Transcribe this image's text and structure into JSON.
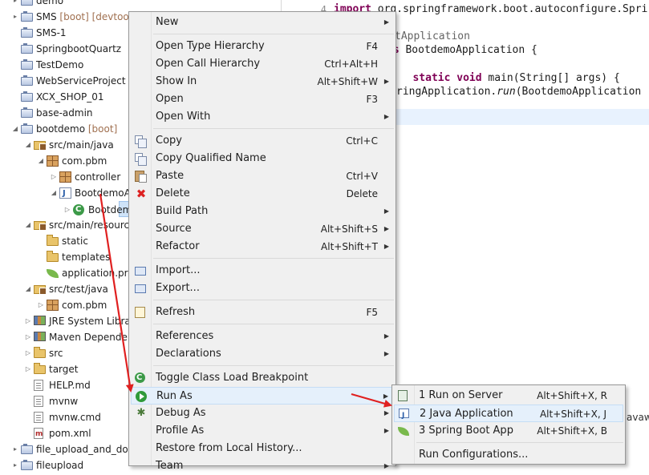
{
  "tree": {
    "items": [
      {
        "label": "demo",
        "decoration": "",
        "indent": 0,
        "icon": "project-icon",
        "twisty": "▸"
      },
      {
        "label": "SMS",
        "decoration": "[boot] [devtoo",
        "indent": 0,
        "icon": "project-icon",
        "twisty": "▸"
      },
      {
        "label": "SMS-1",
        "decoration": "",
        "indent": 0,
        "icon": "project-icon",
        "twisty": ""
      },
      {
        "label": "SpringbootQuartz",
        "decoration": "",
        "indent": 0,
        "icon": "project-icon",
        "twisty": ""
      },
      {
        "label": "TestDemo",
        "decoration": "",
        "indent": 0,
        "icon": "project-icon",
        "twisty": ""
      },
      {
        "label": "WebServiceProject",
        "decoration": "",
        "indent": 0,
        "icon": "project-icon",
        "twisty": ""
      },
      {
        "label": "XCX_SHOP_01",
        "decoration": "",
        "indent": 0,
        "icon": "project-icon",
        "twisty": ""
      },
      {
        "label": "base-admin",
        "decoration": "",
        "indent": 0,
        "icon": "project-icon",
        "twisty": ""
      },
      {
        "label": "bootdemo",
        "decoration": "[boot]",
        "indent": 0,
        "icon": "project-icon",
        "twisty": "◢"
      },
      {
        "label": "src/main/java",
        "decoration": "",
        "indent": 1,
        "icon": "source-folder-icon",
        "twisty": "◢"
      },
      {
        "label": "com.pbm",
        "decoration": "",
        "indent": 2,
        "icon": "package-icon",
        "twisty": "◢"
      },
      {
        "label": "controller",
        "decoration": "",
        "indent": 3,
        "icon": "package-icon",
        "twisty": "▷"
      },
      {
        "label": "BootdemoA",
        "decoration": "",
        "indent": 3,
        "icon": "java-file-icon",
        "twisty": "◢"
      },
      {
        "label": "Bootdem",
        "decoration": "",
        "indent": 4,
        "icon": "class-icon",
        "twisty": "▷"
      },
      {
        "label": "src/main/resourc",
        "decoration": "",
        "indent": 1,
        "icon": "source-folder-icon",
        "twisty": "◢"
      },
      {
        "label": "static",
        "decoration": "",
        "indent": 2,
        "icon": "folder-icon",
        "twisty": ""
      },
      {
        "label": "templates",
        "decoration": "",
        "indent": 2,
        "icon": "folder-icon",
        "twisty": ""
      },
      {
        "label": "application.pro",
        "decoration": "",
        "indent": 2,
        "icon": "spring-leaf-icon",
        "twisty": ""
      },
      {
        "label": "src/test/java",
        "decoration": "",
        "indent": 1,
        "icon": "source-folder-icon",
        "twisty": "◢"
      },
      {
        "label": "com.pbm",
        "decoration": "",
        "indent": 2,
        "icon": "package-icon",
        "twisty": "▷"
      },
      {
        "label": "JRE System Libra",
        "decoration": "",
        "indent": 1,
        "icon": "library-icon",
        "twisty": "▷"
      },
      {
        "label": "Maven Depender",
        "decoration": "",
        "indent": 1,
        "icon": "library-icon",
        "twisty": "▷"
      },
      {
        "label": "src",
        "decoration": "",
        "indent": 1,
        "icon": "folder-icon",
        "twisty": "▷"
      },
      {
        "label": "target",
        "decoration": "",
        "indent": 1,
        "icon": "folder-icon",
        "twisty": "▷"
      },
      {
        "label": "HELP.md",
        "decoration": "",
        "indent": 1,
        "icon": "file-icon",
        "twisty": ""
      },
      {
        "label": "mvnw",
        "decoration": "",
        "indent": 1,
        "icon": "file-icon",
        "twisty": ""
      },
      {
        "label": "mvnw.cmd",
        "decoration": "",
        "indent": 1,
        "icon": "file-icon",
        "twisty": ""
      },
      {
        "label": "pom.xml",
        "decoration": "",
        "indent": 1,
        "icon": "xml-file-icon",
        "twisty": ""
      },
      {
        "label": "file_upload_and_dov",
        "decoration": "",
        "indent": 0,
        "icon": "project-icon",
        "twisty": "▸"
      },
      {
        "label": "fileupload",
        "decoration": "",
        "indent": 0,
        "icon": "project-icon",
        "twisty": "▸"
      }
    ]
  },
  "editor": {
    "lines": [
      {
        "num": "4",
        "segments": [
          {
            "t": "import",
            "c": "kw"
          },
          {
            "t": " org.springframework.boot.autoconfigure.Spri",
            "c": ""
          }
        ]
      },
      {
        "num": "",
        "segments": []
      },
      {
        "num": "",
        "segments": [
          {
            "t": "tApplication",
            "c": "ann"
          }
        ]
      },
      {
        "num": "",
        "segments": [
          {
            "t": "ss",
            "c": "kw"
          },
          {
            "t": " BootdemoApplication ",
            "c": ""
          },
          {
            "t": "{",
            "c": ""
          }
        ]
      },
      {
        "num": "",
        "segments": []
      },
      {
        "num": "",
        "segments": [
          {
            "t": "   static void",
            "c": "kw"
          },
          {
            "t": " main(String[] args) {",
            "c": ""
          }
        ]
      },
      {
        "num": "",
        "segments": [
          {
            "t": "ringApplication.",
            "c": ""
          },
          {
            "t": "run",
            "c": "ital"
          },
          {
            "t": "(BootdemoApplication",
            "c": ""
          }
        ]
      }
    ],
    "bottom_tab": "avaw"
  },
  "context_menu": {
    "items": [
      {
        "label": "New",
        "shortcut": "",
        "submenu": true,
        "icon": ""
      },
      {
        "sep": true
      },
      {
        "label": "Open Type Hierarchy",
        "shortcut": "F4",
        "submenu": false,
        "icon": ""
      },
      {
        "label": "Open Call Hierarchy",
        "shortcut": "Ctrl+Alt+H",
        "submenu": false,
        "icon": ""
      },
      {
        "label": "Show In",
        "shortcut": "Alt+Shift+W",
        "submenu": true,
        "icon": ""
      },
      {
        "label": "Open",
        "shortcut": "F3",
        "submenu": false,
        "icon": ""
      },
      {
        "label": "Open With",
        "shortcut": "",
        "submenu": true,
        "icon": ""
      },
      {
        "sep": true
      },
      {
        "label": "Copy",
        "shortcut": "Ctrl+C",
        "submenu": false,
        "icon": "copy-icon"
      },
      {
        "label": "Copy Qualified Name",
        "shortcut": "",
        "submenu": false,
        "icon": "copy-icon"
      },
      {
        "label": "Paste",
        "shortcut": "Ctrl+V",
        "submenu": false,
        "icon": "paste-icon"
      },
      {
        "label": "Delete",
        "shortcut": "Delete",
        "submenu": false,
        "icon": "delete-icon"
      },
      {
        "label": "Build Path",
        "shortcut": "",
        "submenu": true,
        "icon": ""
      },
      {
        "label": "Source",
        "shortcut": "Alt+Shift+S",
        "submenu": true,
        "icon": ""
      },
      {
        "label": "Refactor",
        "shortcut": "Alt+Shift+T",
        "submenu": true,
        "icon": ""
      },
      {
        "sep": true
      },
      {
        "label": "Import...",
        "shortcut": "",
        "submenu": false,
        "icon": "import-icon"
      },
      {
        "label": "Export...",
        "shortcut": "",
        "submenu": false,
        "icon": "export-icon"
      },
      {
        "sep": true
      },
      {
        "label": "Refresh",
        "shortcut": "F5",
        "submenu": false,
        "icon": "refresh-icon"
      },
      {
        "sep": true
      },
      {
        "label": "References",
        "shortcut": "",
        "submenu": true,
        "icon": ""
      },
      {
        "label": "Declarations",
        "shortcut": "",
        "submenu": true,
        "icon": ""
      },
      {
        "sep": true
      },
      {
        "label": "Toggle Class Load Breakpoint",
        "shortcut": "",
        "submenu": false,
        "icon": "toggle-breakpoint-icon"
      },
      {
        "label": "Run As",
        "shortcut": "",
        "submenu": true,
        "icon": "run-icon",
        "hover": true
      },
      {
        "label": "Debug As",
        "shortcut": "",
        "submenu": true,
        "icon": "debug-icon"
      },
      {
        "label": "Profile As",
        "shortcut": "",
        "submenu": true,
        "icon": ""
      },
      {
        "label": "Restore from Local History...",
        "shortcut": "",
        "submenu": false,
        "icon": ""
      },
      {
        "label": "Team",
        "shortcut": "",
        "submenu": true,
        "icon": ""
      }
    ]
  },
  "run_as_submenu": {
    "items": [
      {
        "label": "1 Run on Server",
        "shortcut": "Alt+Shift+X, R",
        "icon": "run-on-server-icon"
      },
      {
        "label": "2 Java Application",
        "shortcut": "Alt+Shift+X, J",
        "icon": "java-application-icon",
        "hover": true
      },
      {
        "label": "3 Spring Boot App",
        "shortcut": "Alt+Shift+X, B",
        "icon": "spring-boot-icon"
      },
      {
        "sep": true
      },
      {
        "label": "Run Configurations...",
        "shortcut": "",
        "icon": ""
      }
    ]
  },
  "colors": {
    "arrow": "#e02020",
    "keyword": "#7f0055",
    "menu_bg": "#f0f0f0",
    "hover": "#e5f0fb"
  }
}
